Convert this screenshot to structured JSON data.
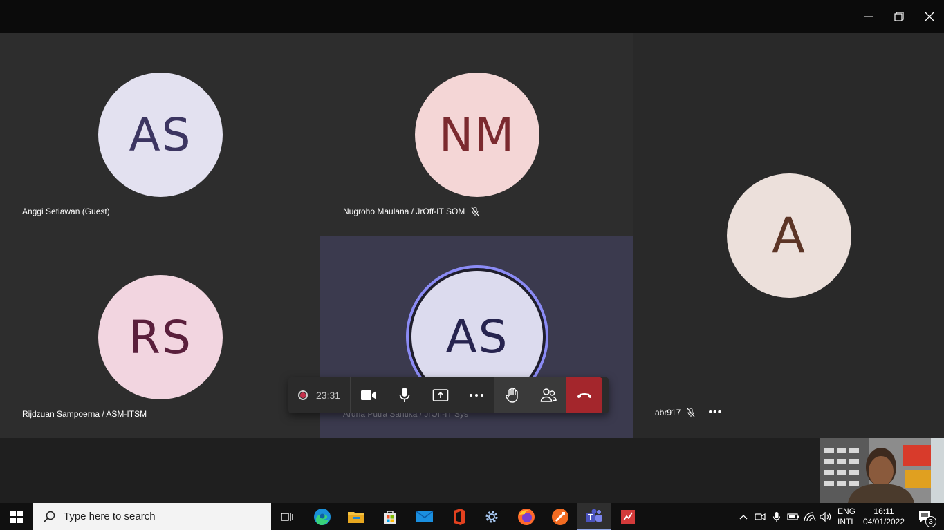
{
  "window": {
    "controls": [
      "minimize-icon",
      "restore-icon",
      "close-icon"
    ]
  },
  "participants": [
    {
      "initials": "AS",
      "name": "Anggi Setiawan (Guest)",
      "muted": false,
      "avatar_bg": "#e3e1f0",
      "avatar_fg": "#3c3561"
    },
    {
      "initials": "NM",
      "name": "Nugroho Maulana / JrOff-IT SOM",
      "muted": true,
      "avatar_bg": "#f4d6d6",
      "avatar_fg": "#7b2a2f"
    },
    {
      "initials": "A",
      "name": "abr917",
      "muted": true,
      "avatar_bg": "#ece0db",
      "avatar_fg": "#5c3526"
    },
    {
      "initials": "RS",
      "name": "Rijdzuan Sampoerna / ASM-ITSM",
      "muted": false,
      "avatar_bg": "#f2d5e0",
      "avatar_fg": "#5a1f3c"
    },
    {
      "initials": "AS",
      "name": "Ardha Putra Santika / JrOff-IT Sys",
      "muted": false,
      "speaking": true,
      "avatar_bg": "#dcdbee",
      "avatar_fg": "#27244f"
    }
  ],
  "callbar": {
    "timer": "23:31",
    "buttons": [
      "camera-icon",
      "microphone-icon",
      "share-screen-icon",
      "more-options-icon",
      "raise-hand-icon",
      "participants-icon",
      "hang-up-icon"
    ]
  },
  "taskbar": {
    "search_placeholder": "Type here to search",
    "apps": [
      "task-view-icon",
      "edge-icon",
      "file-explorer-icon",
      "store-icon",
      "mail-icon",
      "office-icon",
      "settings-icon",
      "firefox-icon",
      "app-orange-icon",
      "teams-icon",
      "app-red-icon"
    ],
    "active_app": "teams-icon",
    "language_line1": "ENG",
    "language_line2": "INTL",
    "time": "16:11",
    "date": "04/01/2022",
    "notifications_count": "3"
  },
  "colors": {
    "titlebar": "#0b0b0b",
    "stage": "#292929",
    "tile_dark": "#2d2d2d",
    "tile_speaking": "#3b3a4e",
    "speaking_ring": "#8b8bf5",
    "hangup": "#a4262c"
  }
}
